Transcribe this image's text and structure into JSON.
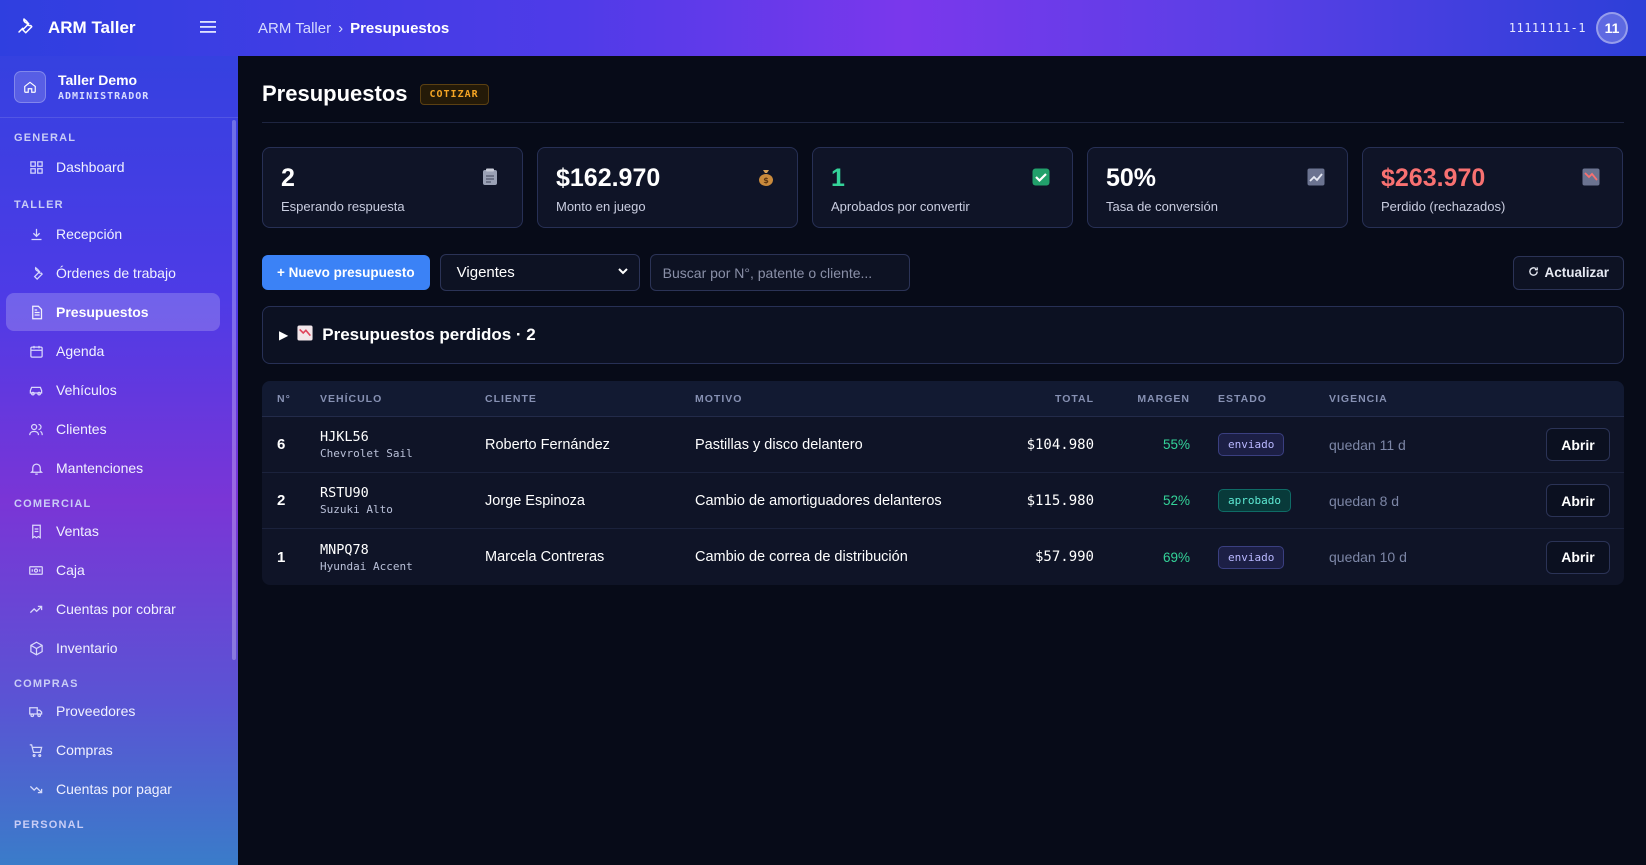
{
  "app": {
    "brand": "ARM Taller",
    "breadcrumb": {
      "root": "ARM Taller",
      "separator": "›",
      "current": "Presupuestos"
    },
    "user_id": "11111111-1",
    "avatar_text": "11"
  },
  "sidebar": {
    "shop_name": "Taller Demo",
    "shop_role": "ADMINISTRADOR",
    "sections": {
      "general": "GENERAL",
      "taller": "TALLER",
      "comercial": "COMERCIAL",
      "compras": "COMPRAS",
      "personal": "PERSONAL"
    },
    "items": {
      "dashboard": "Dashboard",
      "recepcion": "Recepción",
      "ordenes": "Órdenes de trabajo",
      "presupuestos": "Presupuestos",
      "agenda": "Agenda",
      "vehiculos": "Vehículos",
      "clientes": "Clientes",
      "mantenciones": "Mantenciones",
      "ventas": "Ventas",
      "caja": "Caja",
      "cuentas_cobrar": "Cuentas por cobrar",
      "inventario": "Inventario",
      "proveedores": "Proveedores",
      "compras": "Compras",
      "cuentas_pagar": "Cuentas por pagar"
    }
  },
  "page": {
    "title": "Presupuestos",
    "badge": "COTIZAR"
  },
  "stats": [
    {
      "value": "2",
      "label": "Esperando respuesta",
      "icon": "clipboard-icon",
      "color": "#ffffff"
    },
    {
      "value": "$162.970",
      "label": "Monto en juego",
      "icon": "money-bag-icon",
      "color": "#ffffff"
    },
    {
      "value": "1",
      "label": "Aprobados por convertir",
      "icon": "check-box-icon",
      "color": "#34d399"
    },
    {
      "value": "50%",
      "label": "Tasa de conversión",
      "icon": "chart-up-icon",
      "color": "#ffffff"
    },
    {
      "value": "$263.970",
      "label": "Perdido (rechazados)",
      "icon": "chart-down-icon",
      "color": "#f87171"
    }
  ],
  "toolbar": {
    "new_button": "+ Nuevo presupuesto",
    "filter_value": "Vigentes",
    "search_placeholder": "Buscar por N°, patente o cliente...",
    "refresh_button": "Actualizar"
  },
  "lost_section": {
    "title": "Presupuestos perdidos · 2"
  },
  "table": {
    "headers": {
      "n": "N°",
      "vehiculo": "VEHÍCULO",
      "cliente": "CLIENTE",
      "motivo": "MOTIVO",
      "total": "TOTAL",
      "margen": "MARGEN",
      "estado": "ESTADO",
      "vigencia": "VIGENCIA"
    },
    "open_label": "Abrir",
    "rows": [
      {
        "n": "6",
        "plate": "HJKL56",
        "model": "Chevrolet Sail",
        "client": "Roberto Fernández",
        "reason": "Pastillas y disco delantero",
        "total": "$104.980",
        "margin": "55%",
        "status": "enviado",
        "validity": "quedan 11 d"
      },
      {
        "n": "2",
        "plate": "RSTU90",
        "model": "Suzuki Alto",
        "client": "Jorge Espinoza",
        "reason": "Cambio de amortiguadores delanteros",
        "total": "$115.980",
        "margin": "52%",
        "status": "aprobado",
        "validity": "quedan 8 d"
      },
      {
        "n": "1",
        "plate": "MNPQ78",
        "model": "Hyundai Accent",
        "client": "Marcela Contreras",
        "reason": "Cambio de correa de distribución",
        "total": "$57.990",
        "margin": "69%",
        "status": "enviado",
        "validity": "quedan 10 d"
      }
    ]
  }
}
